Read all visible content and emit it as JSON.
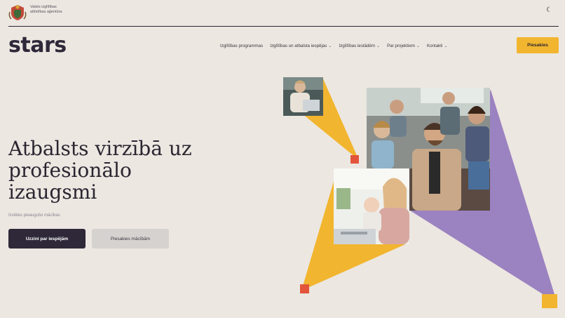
{
  "header": {
    "agency_name_line1": "Valsts izglītības",
    "agency_name_line2": "attīstības aģentūra",
    "theme_toggle_icon": "moon-icon"
  },
  "brand": {
    "logo_text": "stars"
  },
  "nav": {
    "items": [
      {
        "label": "Izglītības programmas",
        "has_dropdown": false
      },
      {
        "label": "Izglītības un atbalsta iespējas",
        "has_dropdown": true
      },
      {
        "label": "Izglītības iestādēm",
        "has_dropdown": true
      },
      {
        "label": "Par projektiem",
        "has_dropdown": true
      },
      {
        "label": "Kontakti",
        "has_dropdown": true
      }
    ],
    "cta_label": "Piesakies"
  },
  "hero": {
    "title_line1": "Atbalsts virzībā uz",
    "title_line2": "profesionālo",
    "title_line3": "izaugsmi",
    "subtitle": "Izvēlies pieaugušo mācības",
    "primary_button": "Uzzini par iespējām",
    "secondary_button": "Piesakies mācībām"
  },
  "colors": {
    "background": "#ece7e1",
    "accent_yellow": "#f2b52f",
    "accent_purple": "#9b82c0",
    "accent_red": "#e2553a",
    "dark": "#2e2839"
  }
}
